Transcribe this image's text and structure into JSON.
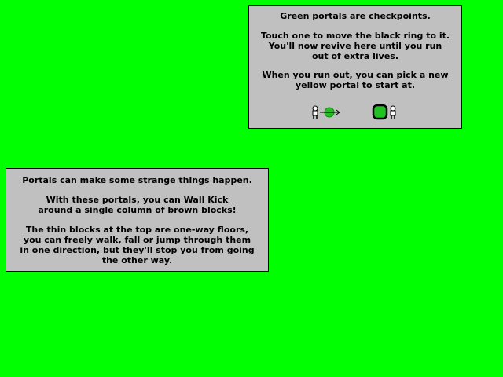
{
  "checkpoint_panel": {
    "lines": [
      "Green portals are checkpoints.",
      "Touch one to move the black ring to it.",
      "You'll now revive here until you run",
      "out of extra lives.",
      "When you run out, you can pick a new",
      "yellow portal to start at."
    ],
    "icons": [
      "player-icon",
      "green-portal-icon",
      "arrow-icon",
      "ringed-portal-icon",
      "player-icon"
    ]
  },
  "portal_panel": {
    "lines": [
      "Portals can make some strange things happen.",
      "With these portals, you can Wall Kick",
      "around a single column of brown blocks!",
      "The thin blocks at the top are one-way floors,",
      "you can freely walk, fall or jump through them",
      "in one direction, but they'll stop you from going",
      "the other way."
    ]
  },
  "colors": {
    "background": "#00ff00",
    "panel": "#c0c0c0",
    "portal_green": "#22c022",
    "ring": "#000000"
  }
}
